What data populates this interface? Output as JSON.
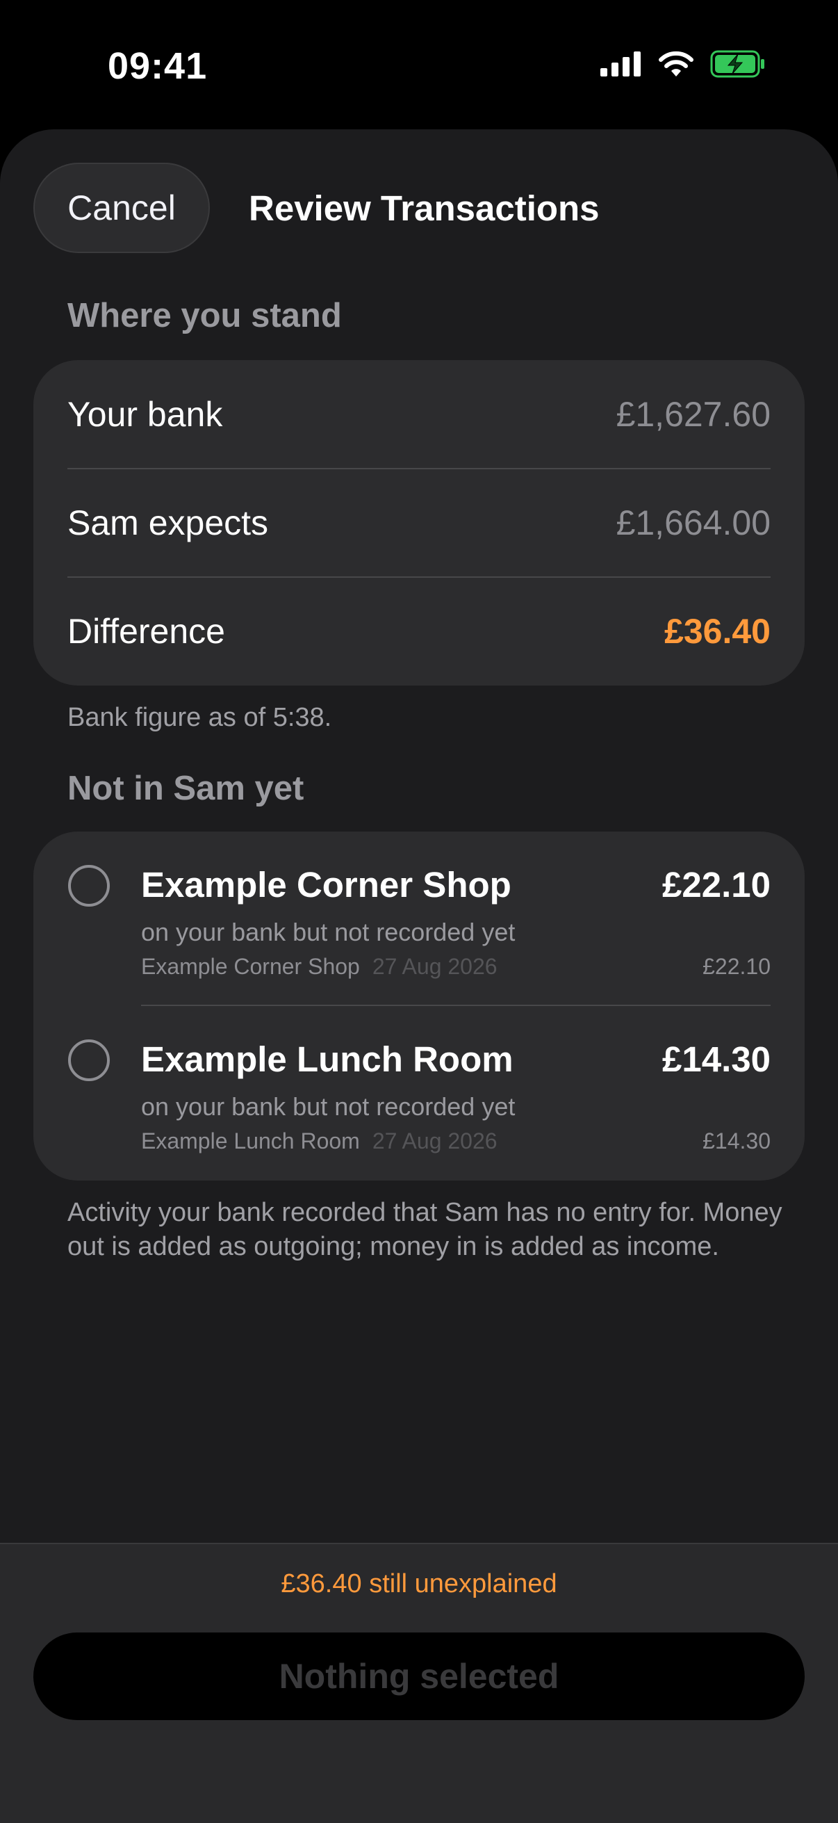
{
  "status_bar": {
    "time": "09:41",
    "icons": [
      "cellular-signal-icon",
      "wifi-icon",
      "battery-charging-icon"
    ],
    "battery_color": "#34c759"
  },
  "header": {
    "cancel_label": "Cancel",
    "title": "Review Transactions"
  },
  "summary": {
    "heading": "Where you stand",
    "rows": [
      {
        "label": "Your bank",
        "value": "£1,627.60"
      },
      {
        "label": "Sam expects",
        "value": "£1,664.00"
      },
      {
        "label": "Difference",
        "value": "£36.40"
      }
    ],
    "footnote": "Bank figure as of 5:38."
  },
  "pending": {
    "heading": "Not in Sam yet",
    "items": [
      {
        "name": "Example Corner Shop",
        "amount": "£22.10",
        "status": "on your bank but not recorded yet",
        "bank_name": "Example Corner Shop",
        "date": "27 Aug 2026",
        "bank_amount": "£22.10"
      },
      {
        "name": "Example Lunch Room",
        "amount": "£14.30",
        "status": "on your bank but not recorded yet",
        "bank_name": "Example Lunch Room",
        "date": "27 Aug 2026",
        "bank_amount": "£14.30"
      }
    ],
    "explanation": "Activity your bank recorded that Sam has no entry for. Money out is added as outgoing; money in is added as income."
  },
  "footer": {
    "unexplained_text": "£36.40 still unexplained",
    "button_label": "Nothing selected"
  },
  "colors": {
    "accent": "#ff9a3c",
    "background": "#1c1c1e",
    "card": "#2c2c2e"
  }
}
